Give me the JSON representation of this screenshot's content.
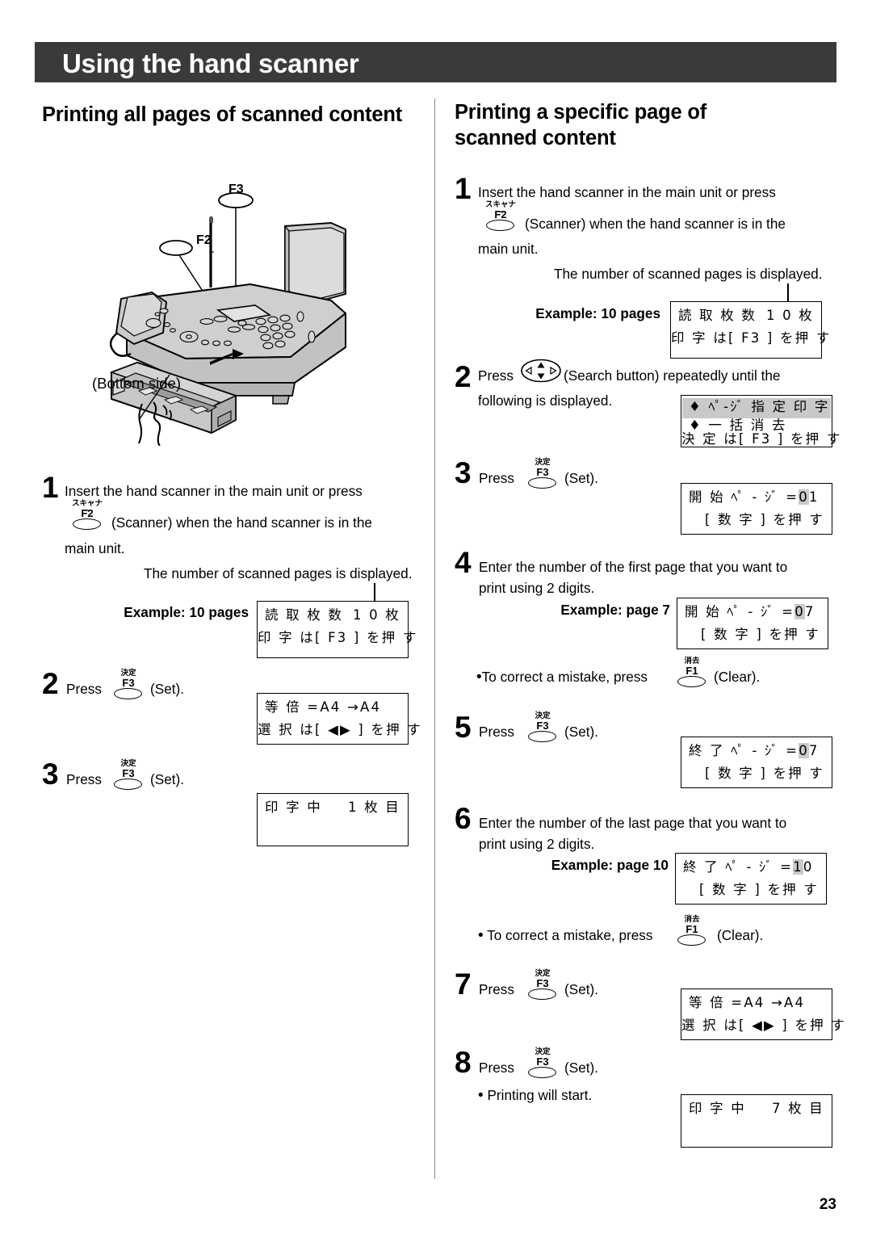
{
  "header": {
    "title": "Using the hand scanner"
  },
  "page_number": "23",
  "left_column": {
    "section_title": "Printing all pages of scanned content",
    "figure": {
      "label_f3": "F3",
      "label_f2": "F2",
      "label_bottom_side": "(Bottom side)"
    },
    "steps": [
      {
        "num": "1",
        "text_a": "Insert the hand scanner in the main unit or press",
        "key": {
          "cap": "スキャナー",
          "label": "F2"
        },
        "text_b": "(Scanner) when the hand scanner is in the",
        "text_c": "main unit.",
        "note": "The number of scanned pages is displayed.",
        "example_label": "Example: 10 pages",
        "lcd": {
          "line1_left": "読 取 枚 数",
          "line1_right": "1 0 枚",
          "line2_right": "印 字 は[ F3 ] を押 す"
        }
      },
      {
        "num": "2",
        "text_a": "Press",
        "key": {
          "cap": "決定",
          "label": "F3"
        },
        "text_b": "(Set).",
        "lcd": {
          "line1_left": "等 倍 =A4 →A4",
          "line2_right": "選 択 は[ ◀▶ ] を押 す"
        }
      },
      {
        "num": "3",
        "text_a": "Press",
        "key": {
          "cap": "決定",
          "label": "F3"
        },
        "text_b": "(Set).",
        "lcd": {
          "line1_left": "印 字 中",
          "line1_right": "1 枚 目"
        }
      }
    ]
  },
  "right_column": {
    "section_title": "Printing a specific page of scanned content",
    "steps": [
      {
        "num": "1",
        "text_a": "Insert the hand scanner in the main unit or press",
        "key": {
          "cap": "スキャナー",
          "label": "F2"
        },
        "text_b": "(Scanner) when the hand scanner is in the",
        "text_c": "main unit.",
        "note": "The number of scanned pages is displayed.",
        "example_label": "Example: 10 pages",
        "lcd": {
          "line1_left": "読 取 枚 数",
          "line1_right": "1 0 枚",
          "line2_right": "印 字 は[ F3 ] を押 す"
        }
      },
      {
        "num": "2",
        "text_a": "Press",
        "key_icon": "search-button-icon",
        "text_b": "(Search button) repeatedly until the",
        "text_c": "following is displayed.",
        "lcd": {
          "line1": "♦ ﾍﾟ-ｼﾞ 指 定 印 字",
          "line2": "♦ 一 括 消 去",
          "line3_right": "決 定 は[ F3 ] を押 す"
        }
      },
      {
        "num": "3",
        "text_a": "Press",
        "key": {
          "cap": "決定",
          "label": "F3"
        },
        "text_b": "(Set).",
        "lcd": {
          "line1_prefix": "開 始 ﾍﾟ - ｼﾞ =",
          "line1_hl": "0",
          "line1_rest": "1",
          "line2_right": "[ 数 字 ] を押 す"
        }
      },
      {
        "num": "4",
        "text_a": "Enter the number of the first page that you want to",
        "text_b": "print using 2 digits.",
        "example_label": "Example: page 7",
        "lcd": {
          "line1_prefix": "開 始 ﾍﾟ - ｼﾞ =",
          "line1_hl": "0",
          "line1_rest": "7",
          "line2_right": "[ 数 字 ] を押 す"
        },
        "bullet_a": "To correct a mistake, press",
        "bullet_key": {
          "cap": "消去",
          "label": "F1"
        },
        "bullet_b": "(Clear)."
      },
      {
        "num": "5",
        "text_a": "Press",
        "key": {
          "cap": "決定",
          "label": "F3"
        },
        "text_b": "(Set).",
        "lcd": {
          "line1_prefix": "終 了 ﾍﾟ - ｼﾞ =",
          "line1_hl": "0",
          "line1_rest": "7",
          "line2_right": "[ 数 字 ] を押 す"
        }
      },
      {
        "num": "6",
        "text_a": "Enter the number of the last page that you want to",
        "text_b": "print using 2 digits.",
        "example_label": "Example: page 10",
        "lcd": {
          "line1_prefix": "終 了 ﾍﾟ - ｼﾞ =",
          "line1_hl": "1",
          "line1_rest": "0",
          "line2_right": "[ 数 字 ] を押 す"
        },
        "bullet_a": "To correct a mistake, press",
        "bullet_key": {
          "cap": "消去",
          "label": "F1"
        },
        "bullet_b": "(Clear)."
      },
      {
        "num": "7",
        "text_a": "Press",
        "key": {
          "cap": "決定",
          "label": "F3"
        },
        "text_b": "(Set).",
        "lcd": {
          "line1_left": "等 倍 =A4 →A4",
          "line2_right": "選 択 は[ ◀▶ ] を押 す"
        }
      },
      {
        "num": "8",
        "text_a": "Press",
        "key": {
          "cap": "決定",
          "label": "F3"
        },
        "text_b": "(Set).",
        "bullet_a": "Printing will start.",
        "lcd": {
          "line1_left": "印 字 中",
          "line1_right": "7 枚 目"
        }
      }
    ]
  },
  "colors": {
    "header_bar": "#3a3a3a",
    "lcd_highlight": "#c9c9c9",
    "figure_fill": "#c9c9c9"
  }
}
